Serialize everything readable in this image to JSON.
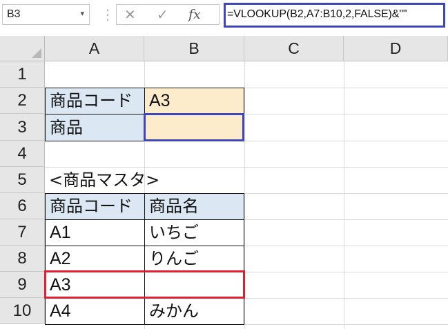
{
  "formula_bar": {
    "name_box": "B3",
    "name_box_arrow": "▾",
    "separator": "⋮",
    "cancel_icon": "✕",
    "enter_icon": "✓",
    "fx_label": "fx",
    "formula": "=VLOOKUP(B2,A7:B10,2,FALSE)&\"\""
  },
  "columns": [
    "A",
    "B",
    "C",
    "D"
  ],
  "rows": [
    "1",
    "2",
    "3",
    "4",
    "5",
    "6",
    "7",
    "8",
    "9",
    "10"
  ],
  "cells": {
    "A2": "商品コード",
    "B2": "A3",
    "A3": "商品",
    "B3": "",
    "A5": "<商品マスタ>",
    "A6": "商品コード",
    "B6": "商品名",
    "A7": "A1",
    "B7": "いちご",
    "A8": "A2",
    "B8": "りんご",
    "A9": "A3",
    "B9": "",
    "A10": "A4",
    "B10": "みかん"
  },
  "colors": {
    "selection_blue": "#3f47b8",
    "highlight_red": "#e02030",
    "header_fill": "#dbe8f4",
    "input_fill": "#fdeccc"
  }
}
